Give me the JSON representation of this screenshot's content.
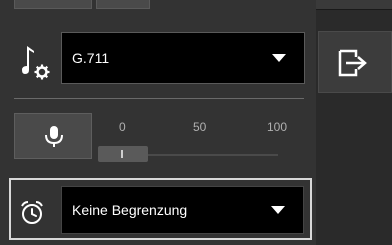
{
  "codec": {
    "selected": "G.711"
  },
  "mic_volume": {
    "tick_min": "0",
    "tick_mid": "50",
    "tick_max": "100",
    "level_percent": 10
  },
  "limit": {
    "selected": "Keine Begrenzung"
  },
  "icons": {
    "codec": "music-note-gear-icon",
    "mic": "microphone-icon",
    "limit": "alarm-clock-icon",
    "dropdown": "chevron-down-icon",
    "right": "exit-arrow-icon"
  }
}
